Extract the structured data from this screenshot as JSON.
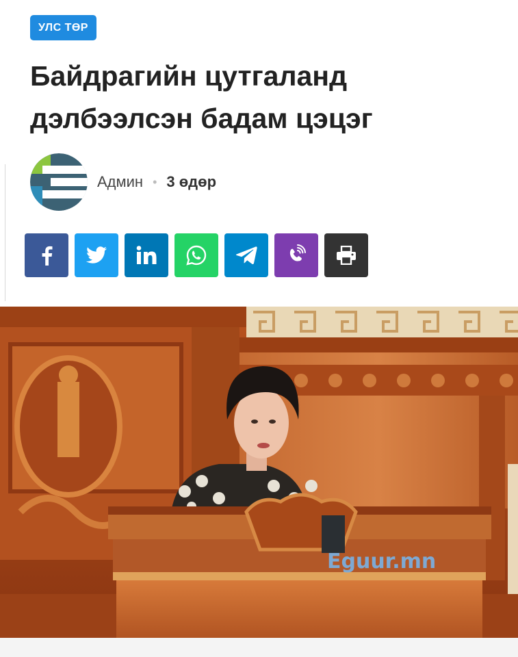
{
  "article": {
    "category": "УЛС ТӨР",
    "title_line1": "Байдрагийн цутгаланд",
    "title_line2": "дэлбээлсэн бадам цэцэг",
    "author": "Админ",
    "separator": "•",
    "date": "3 өдөр"
  },
  "share_buttons": [
    {
      "name": "facebook",
      "icon": "facebook-icon",
      "color": "#3b5998"
    },
    {
      "name": "twitter",
      "icon": "twitter-icon",
      "color": "#1da1f2"
    },
    {
      "name": "linkedin",
      "icon": "linkedin-icon",
      "color": "#0077b5"
    },
    {
      "name": "whatsapp",
      "icon": "whatsapp-icon",
      "color": "#25d366"
    },
    {
      "name": "telegram",
      "icon": "telegram-icon",
      "color": "#0088cc"
    },
    {
      "name": "viber",
      "icon": "viber-icon",
      "color": "#7d3daf"
    },
    {
      "name": "print",
      "icon": "print-icon",
      "color": "#333333"
    }
  ],
  "photo": {
    "watermark": "Eguur.mn"
  },
  "colors": {
    "badge": "#1f8be0",
    "title": "#222222"
  }
}
